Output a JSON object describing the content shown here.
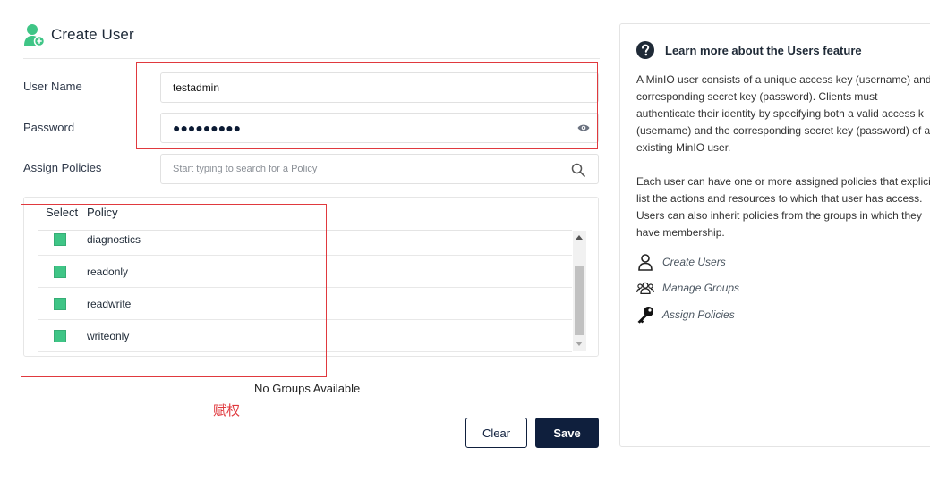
{
  "header": {
    "title": "Create User"
  },
  "form": {
    "username": {
      "label": "User Name",
      "value": "testadmin"
    },
    "password": {
      "label": "Password",
      "masked_value": "●●●●●●●●●"
    },
    "assign_policies": {
      "label": "Assign Policies",
      "placeholder": "Start typing to search for a Policy"
    }
  },
  "policy_table": {
    "columns": [
      "Select",
      "Policy"
    ],
    "rows": [
      {
        "name": "diagnostics",
        "selected": true
      },
      {
        "name": "readonly",
        "selected": true
      },
      {
        "name": "readwrite",
        "selected": true
      },
      {
        "name": "writeonly",
        "selected": true
      }
    ]
  },
  "groups": {
    "empty_text": "No Groups Available"
  },
  "annotation": {
    "text": "赋权"
  },
  "buttons": {
    "clear": "Clear",
    "save": "Save"
  },
  "help": {
    "title": "Learn more about the Users feature",
    "paragraph1": "A MinIO user consists of a unique access key (username) and\ncorresponding secret key (password). Clients must\nauthenticate their identity by specifying both a valid access k\n(username) and the corresponding secret key (password) of a\nexisting MinIO user.",
    "paragraph2": "Each user can have one or more assigned policies that explici\nlist the actions and resources to which that user has access.\nUsers can also inherit policies from the groups in which they\nhave membership.",
    "links": [
      {
        "label": "Create Users",
        "icon": "user-icon"
      },
      {
        "label": "Manage Groups",
        "icon": "users-group-icon"
      },
      {
        "label": "Assign Policies",
        "icon": "key-icon"
      }
    ]
  },
  "colors": {
    "accent": "#0f1f3d",
    "checkbox": "#3fc586",
    "annotation": "#e0393e",
    "title_icon": "#3fc586"
  }
}
